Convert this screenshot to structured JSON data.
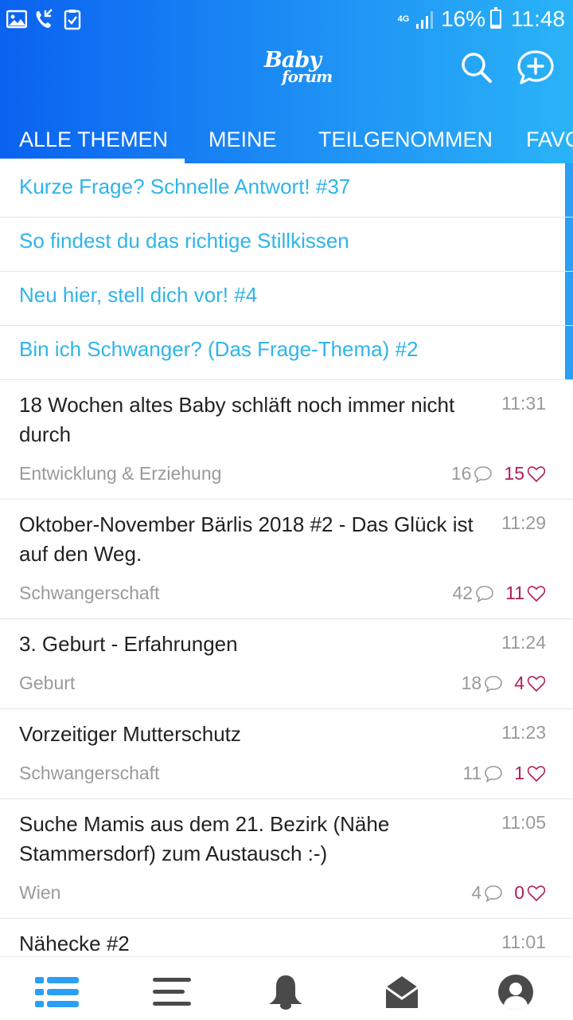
{
  "status_bar": {
    "network": "4G",
    "battery": "16%",
    "battery_level": 0.16,
    "time": "11:48",
    "icons": [
      "image-icon",
      "phone-call-icon",
      "clipboard-check-icon",
      "signal-icon",
      "battery-icon"
    ]
  },
  "header": {
    "logo_line1": "Baby",
    "logo_line2": "forum",
    "icons": [
      "search-icon",
      "new-post-bubble-icon"
    ]
  },
  "tabs": [
    {
      "label": "ALLE THEMEN",
      "active": true
    },
    {
      "label": "MEINE",
      "active": false
    },
    {
      "label": "TEILGENOMMEN",
      "active": false
    },
    {
      "label": "FAVO",
      "active": false
    }
  ],
  "pinned": [
    {
      "title": "Kurze Frage? Schnelle Antwort! #37"
    },
    {
      "title": "So findest du das richtige Stillkissen"
    },
    {
      "title": "Neu hier, stell dich vor! #4"
    },
    {
      "title": "Bin ich Schwanger? (Das Frage-Thema) #2"
    }
  ],
  "threads": [
    {
      "title": "18 Wochen altes Baby schläft noch immer nicht durch",
      "time": "11:31",
      "category": "Entwicklung & Erziehung",
      "comments": "16",
      "likes": "15"
    },
    {
      "title": "Oktober-November Bärlis 2018 #2 - Das Glück ist auf den Weg.",
      "time": "11:29",
      "category": "Schwangerschaft",
      "comments": "42",
      "likes": "11"
    },
    {
      "title": "3. Geburt - Erfahrungen",
      "time": "11:24",
      "category": "Geburt",
      "comments": "18",
      "likes": "4"
    },
    {
      "title": "Vorzeitiger Mutterschutz",
      "time": "11:23",
      "category": "Schwangerschaft",
      "comments": "11",
      "likes": "1"
    },
    {
      "title": "Suche Mamis aus dem 21. Bezirk (Nähe Stammersdorf) zum Austausch :-)",
      "time": "11:05",
      "category": "Wien",
      "comments": "4",
      "likes": "0"
    },
    {
      "title": "Nähecke #2",
      "time": "11:01",
      "category": "",
      "comments": "",
      "likes": ""
    }
  ],
  "bottom_nav": [
    {
      "name": "topic-list-icon",
      "active": true
    },
    {
      "name": "menu-icon",
      "active": false
    },
    {
      "name": "bell-icon",
      "active": false
    },
    {
      "name": "mail-icon",
      "active": false
    },
    {
      "name": "profile-icon",
      "active": false
    }
  ],
  "colors": {
    "header_start": "#0a62f0",
    "header_end": "#2ab3f7",
    "pinned_text": "#2fb5e8",
    "likes": "#b01f5a",
    "muted": "#9a9a9a",
    "nav_active": "#2a9ff5",
    "nav_inactive": "#4a4a4a"
  }
}
